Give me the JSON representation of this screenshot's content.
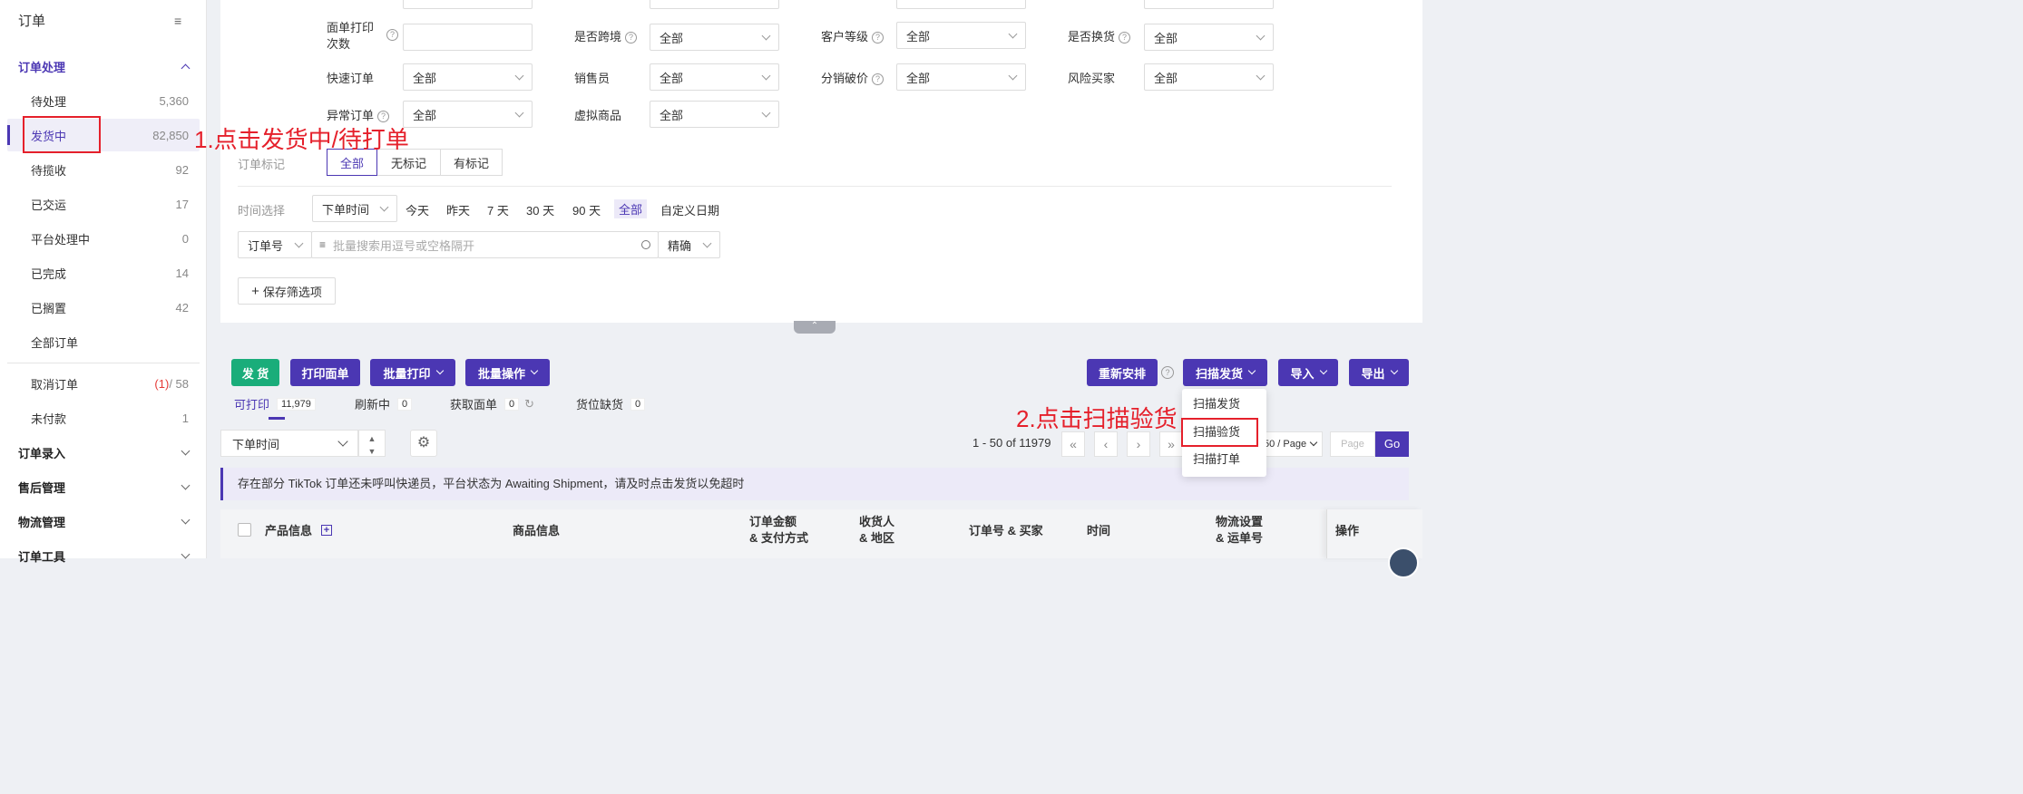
{
  "sidebar": {
    "title": "订单",
    "groups": {
      "order_processing": "订单处理",
      "order_entry": "订单录入",
      "after_sales": "售后管理",
      "logistics": "物流管理",
      "order_tools": "订单工具"
    },
    "items": [
      {
        "label": "待处理",
        "count": "5,360"
      },
      {
        "label": "发货中",
        "count": "82,850"
      },
      {
        "label": "待揽收",
        "count": "92"
      },
      {
        "label": "已交运",
        "count": "17"
      },
      {
        "label": "平台处理中",
        "count": "0"
      },
      {
        "label": "已完成",
        "count": "14"
      },
      {
        "label": "已搁置",
        "count": "42"
      },
      {
        "label": "全部订单",
        "count": ""
      },
      {
        "label": "取消订单",
        "count_red": "(1)",
        "count_rest": "/ 58"
      },
      {
        "label": "未付款",
        "count": "1"
      }
    ]
  },
  "filters": {
    "print_count_label": "面单打印\n次数",
    "cross_border_label": "是否跨境",
    "cross_border_value": "全部",
    "customer_level_label": "客户等级",
    "customer_level_value": "全部",
    "exchange_label": "是否换货",
    "exchange_value": "全部",
    "express_label": "快速订单",
    "express_value": "全部",
    "seller_label": "销售员",
    "seller_value": "全部",
    "dist_price_label": "分销破价",
    "dist_price_value": "全部",
    "risk_buyer_label": "风险买家",
    "risk_buyer_value": "全部",
    "abnormal_label": "异常订单",
    "abnormal_value": "全部",
    "virtual_label": "虚拟商品",
    "virtual_value": "全部",
    "mark_label": "订单标记",
    "mark_options": [
      "全部",
      "无标记",
      "有标记"
    ],
    "time_label": "时间选择",
    "time_type": "下单时间",
    "time_options": [
      "今天",
      "昨天",
      "7 天",
      "30 天",
      "90 天",
      "全部",
      "自定义日期"
    ],
    "search_field": "订单号",
    "search_placeholder": "批量搜索用逗号或空格隔开",
    "search_mode": "精确",
    "save_filter": "保存筛选项"
  },
  "toolbar": {
    "ship": "发 货",
    "print_label": "打印面单",
    "batch_print": "批量打印",
    "batch_ops": "批量操作",
    "reschedule": "重新安排",
    "scan_ship": "扫描发货",
    "import": "导入",
    "export": "导出"
  },
  "scan_menu": [
    "扫描发货",
    "扫描验货",
    "扫描打单"
  ],
  "tabs": [
    {
      "label": "可打印",
      "count": "11,979"
    },
    {
      "label": "刷新中",
      "count": "0"
    },
    {
      "label": "获取面单",
      "count": "0"
    },
    {
      "label": "货位缺货",
      "count": "0"
    }
  ],
  "sort": {
    "field": "下单时间"
  },
  "pagination": {
    "range": "1 - 50 of 11979",
    "page_size": "50 / Page",
    "page_placeholder": "Page",
    "go": "Go"
  },
  "notice": "存在部分 TikTok 订单还未呼叫快递员，平台状态为 Awaiting Shipment，请及时点击发货以免超时",
  "table_headers": {
    "product": "产品信息",
    "goods": "商品信息",
    "amount": "订单金额\n& 支付方式",
    "receiver": "收货人\n& 地区",
    "order_buyer": "订单号 & 买家",
    "time": "时间",
    "logistics": "物流设置\n& 运单号",
    "ops": "操作"
  },
  "annotations": {
    "step1": "1.点击发货中/待打单",
    "step2": "2.点击扫描验货"
  },
  "colors": {
    "accent": "#4b37b3",
    "green": "#1aad7a",
    "annotation": "#e5202b"
  }
}
